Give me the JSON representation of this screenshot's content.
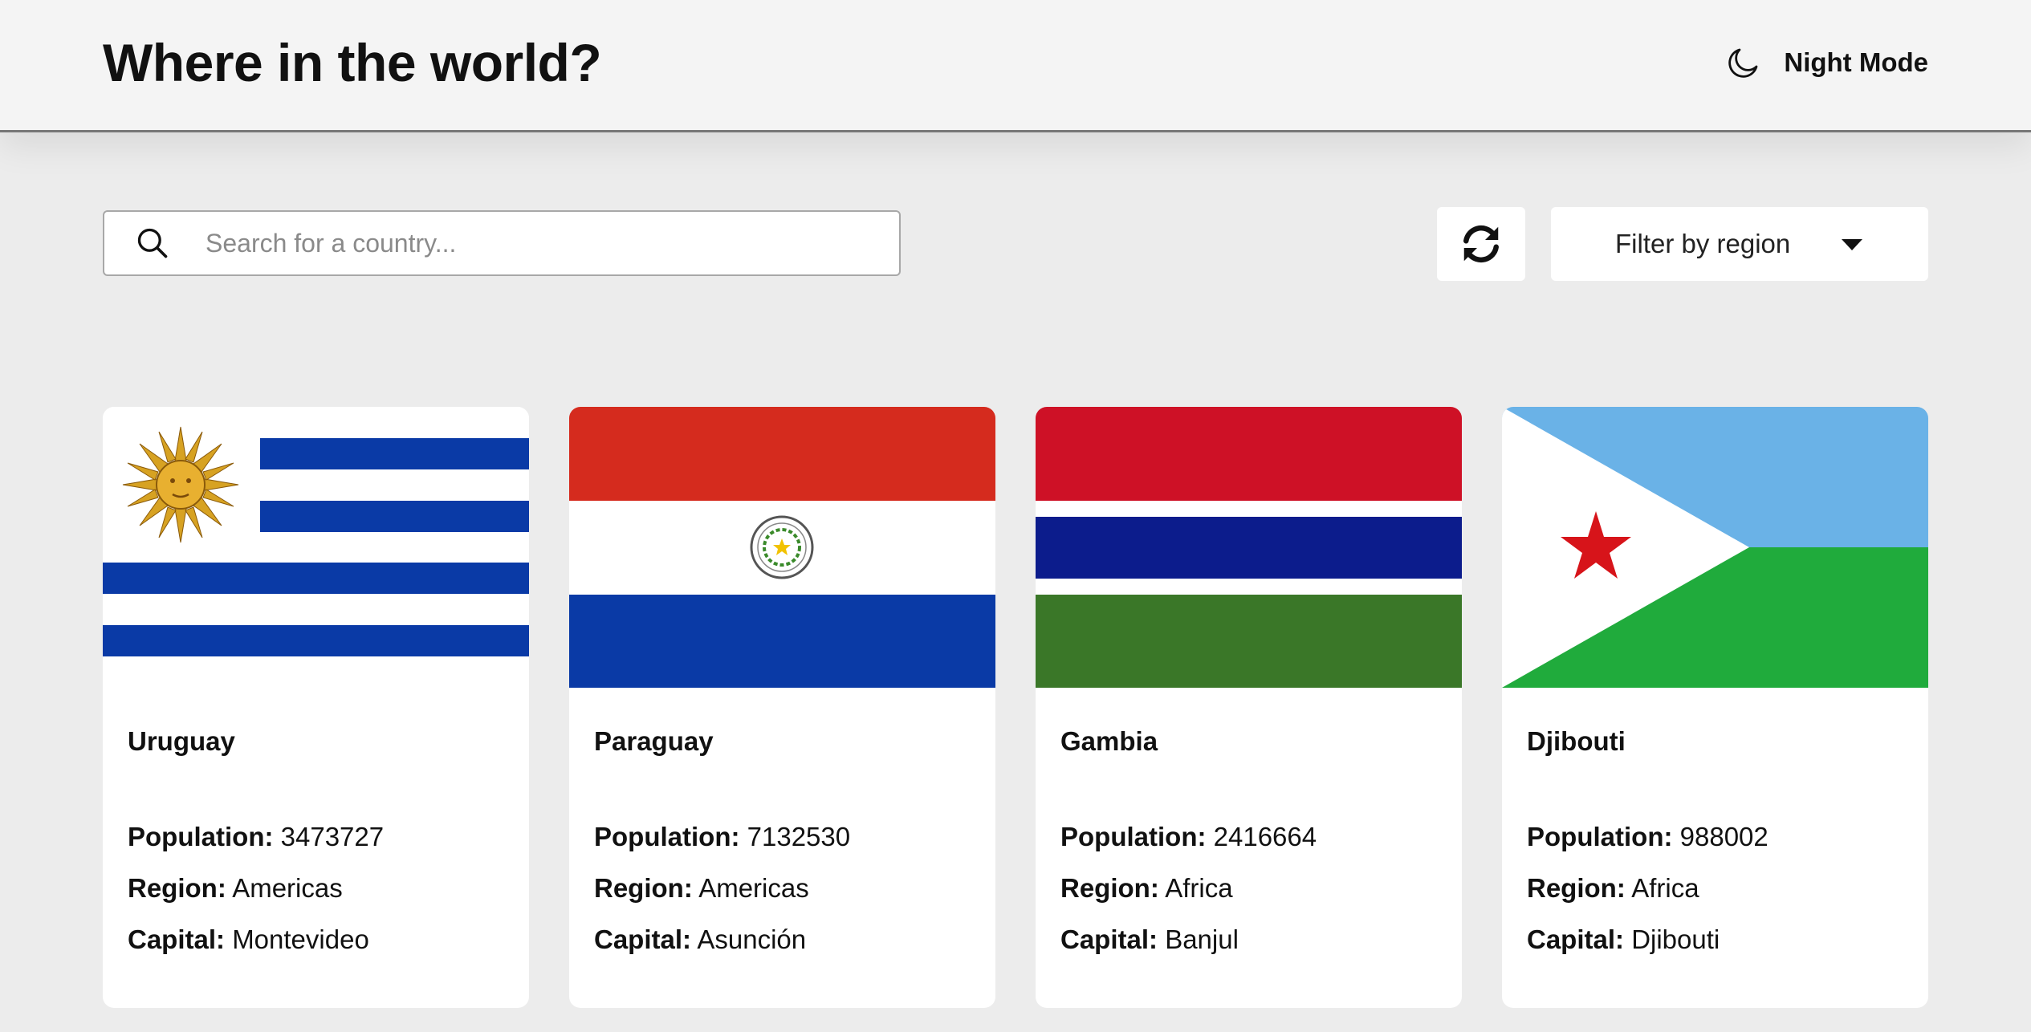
{
  "header": {
    "title": "Where in the world?",
    "mode_label": "Night Mode",
    "mode_icon": "moon-icon"
  },
  "search": {
    "placeholder": "Search for a country...",
    "value": "",
    "icon": "search-icon"
  },
  "controls": {
    "refresh_icon": "refresh-icon",
    "filter_label": "Filter by region",
    "filter_icon": "caret-down-icon"
  },
  "labels": {
    "population": "Population:",
    "region": "Region:",
    "capital": "Capital:"
  },
  "countries": [
    {
      "name": "Uruguay",
      "population": "3473727",
      "region": "Americas",
      "capital": "Montevideo",
      "flag": "uruguay-flag"
    },
    {
      "name": "Paraguay",
      "population": "7132530",
      "region": "Americas",
      "capital": "Asunción",
      "flag": "paraguay-flag"
    },
    {
      "name": "Gambia",
      "population": "2416664",
      "region": "Africa",
      "capital": "Banjul",
      "flag": "gambia-flag"
    },
    {
      "name": "Djibouti",
      "population": "988002",
      "region": "Africa",
      "capital": "Djibouti",
      "flag": "djibouti-flag"
    }
  ],
  "colors": {
    "background": "#ececec",
    "header": "#f4f4f4",
    "card": "#ffffff",
    "text": "#111111"
  }
}
